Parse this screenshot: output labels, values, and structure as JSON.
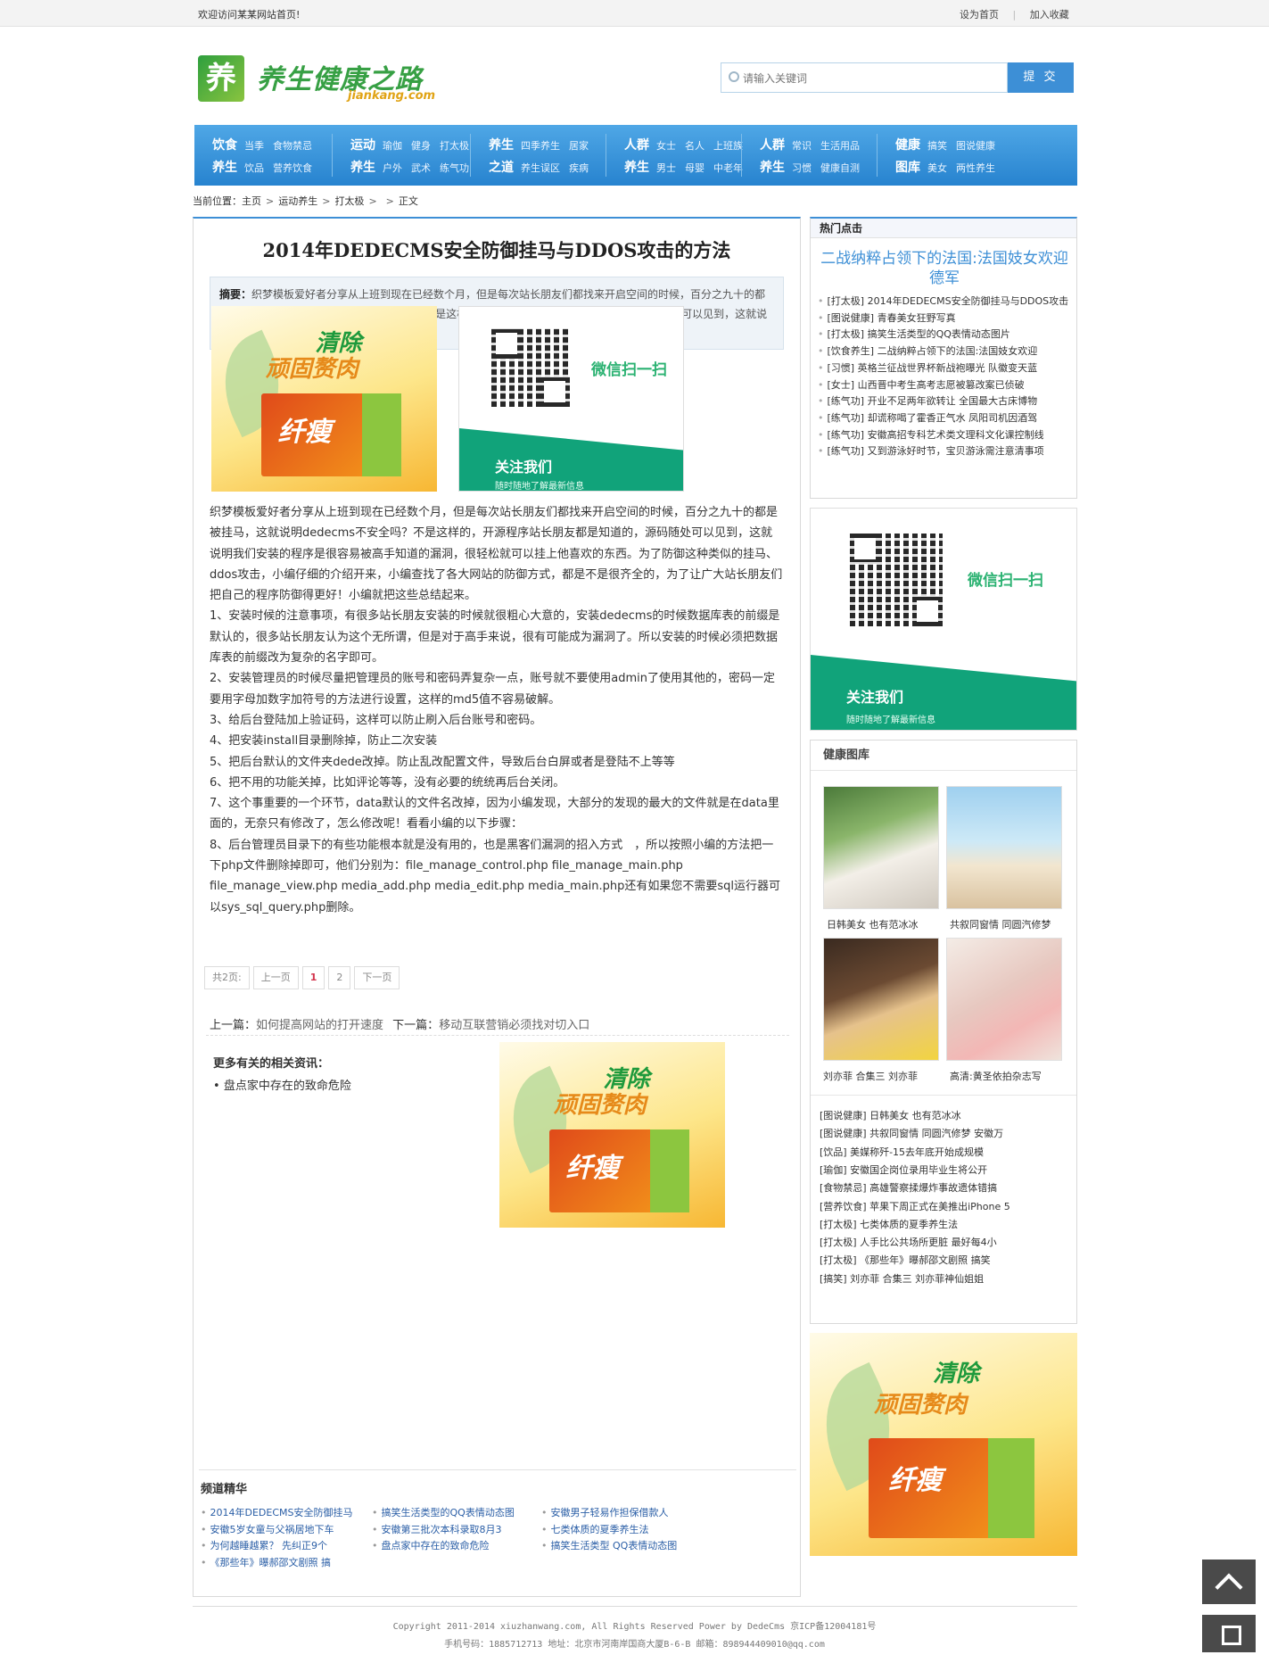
{
  "topbar": {
    "welcome": "欢迎访问某某网站首页!",
    "set_home": "设为首页",
    "add_fav": "加入收藏"
  },
  "logo": {
    "mark": "养",
    "name": "养生健康之路",
    "domain": "jiankang.com"
  },
  "search": {
    "placeholder": "请输入关键词",
    "button": "提 交"
  },
  "nav": [
    {
      "r1_cat": "饮食",
      "r1": [
        "当季",
        "食物禁忌"
      ],
      "r2_cat": "养生",
      "r2": [
        "饮品",
        "营养饮食"
      ]
    },
    {
      "r1_cat": "运动",
      "r1": [
        "瑜伽",
        "健身",
        "打太极"
      ],
      "r2_cat": "养生",
      "r2": [
        "户外",
        "武术",
        "练气功"
      ]
    },
    {
      "r1_cat": "养生",
      "r1": [
        "四季养生",
        "居家"
      ],
      "r2_cat": "之道",
      "r2": [
        "养生误区",
        "疾病"
      ]
    },
    {
      "r1_cat": "人群",
      "r1": [
        "女士",
        "名人",
        "上班族"
      ],
      "r2_cat": "养生",
      "r2": [
        "男士",
        "母婴",
        "中老年"
      ]
    },
    {
      "r1_cat": "人群",
      "r1": [
        "常识",
        "生活用品"
      ],
      "r2_cat": "养生",
      "r2": [
        "习惯",
        "健康自测"
      ]
    },
    {
      "r1_cat": "健康",
      "r1": [
        "搞笑",
        "图说健康"
      ],
      "r2_cat": "图库",
      "r2": [
        "美女",
        "两性养生"
      ]
    }
  ],
  "breadcrumb": {
    "label": "当前位置：",
    "items": [
      "主页",
      "运动养生",
      "打太极",
      "",
      "正文"
    ]
  },
  "article": {
    "title": "2014年DEDECMS安全防御挂马与DDOS攻击的方法",
    "abstract_label": "摘要：",
    "abstract": "织梦模板爱好者分享从上班到现在已经数个月，但是每次站长朋友们都找来开启空间的时候，百分之九十的都是被挂马，这就说明 dedecms 不安全吗？不是这样的，开源程序站长朋友都是知道的，源码随处可以见到，这就说明我们安装的程序是很容易被高手知道的漏洞，",
    "paragraphs": [
      "织梦模板爱好者分享从上班到现在已经数个月，但是每次站长朋友们都找来开启空间的时候，百分之九十的都是被挂马，这就说明dedecms不安全吗？不是这样的，开源程序站长朋友都是知道的，源码随处可以见到，这就说明我们安装的程序是很容易被高手知道的漏洞，很轻松就可以挂上他喜欢的东西。为了防御这种类似的挂马、ddos攻击，小编仔细的介绍开来，小编查找了各大网站的防御方式，都是不是很齐全的，为了让广大站长朋友们把自己的程序防御得更好！小编就把这些总结起来。",
      "1、安装时候的注意事项，有很多站长朋友安装的时候就很粗心大意的，安装dedecms的时候数据库表的前缀是默认的，很多站长朋友认为这个无所谓，但是对于高手来说，很有可能成为漏洞了。所以安装的时候必须把数据库表的前缀改为复杂的名字即可。",
      "2、安装管理员的时候尽量把管理员的账号和密码弄复杂一点，账号就不要使用admin了使用其他的，密码一定要用字母加数字加符号的方法进行设置，这样的md5值不容易破解。",
      "3、给后台登陆加上验证码，这样可以防止刷入后台账号和密码。",
      "4、把安装install目录删除掉，防止二次安装",
      "5、把后台默认的文件夹dede改掉。防止乱改配置文件，导致后台白屏或者是登陆不上等等",
      "6、把不用的功能关掉，比如评论等等，没有必要的统统再后台关闭。",
      "7、这个事重要的一个环节，data默认的文件名改掉，因为小编发现，大部分的发现的最大的文件就是在data里面的，无奈只有修改了，怎么修改呢！看看小编的以下步骤：",
      "8、后台管理员目录下的有些功能根本就是没有用的，也是黑客们漏洞的招入方式　，所以按照小编的方法把一下php文件删除掉即可，他们分别为：file_manage_control.php file_manage_main.php file_manage_view.php media_add.php media_edit.php media_main.php还有如果您不需要sql运行器可以sys_sql_query.php删除。"
    ],
    "promo": {
      "line1": "清除",
      "line2": "顽固赘肉",
      "brand": "纤瘦"
    },
    "qr": {
      "scan": "微信扫一扫",
      "follow": "关注我们",
      "tip": "随时随地了解最新信息"
    }
  },
  "pager": {
    "total": "共2页:",
    "prev": "上一页",
    "p1": "1",
    "p2": "2",
    "next": "下一页"
  },
  "prevnext": {
    "prev_label": "上一篇：",
    "prev_title": "如何提高网站的打开速度",
    "next_label": "下一篇：",
    "next_title": "移动互联营销必须找对切入口"
  },
  "related": {
    "title": "更多有关的相关资讯：",
    "items": [
      "盘点家中存在的致命危险"
    ]
  },
  "channel": {
    "title": "频道精华",
    "items": [
      "2014年DEDECMS安全防御挂马",
      "搞笑生活类型的QQ表情动态图",
      "安徽男子轻易作担保借款人",
      "安徽5岁女童与父祸居地下车",
      "安徽第三批次本科录取8月3",
      "七类体质的夏季养生法",
      "为何越睡越累？ 先纠正9个",
      "盘点家中存在的致命危险",
      "搞笑生活类型 QQ表情动态图",
      "《那些年》曝郝邵文剧照 搞"
    ]
  },
  "hot": {
    "title": "热门点击",
    "headline": "二战纳粹占领下的法国:法国妓女欢迎德军",
    "items": [
      "[打太极] 2014年DEDECMS安全防御挂马与DDOS攻击",
      "[图说健康] 青春美女狂野写真",
      "[打太极] 搞笑生活类型的QQ表情动态图片",
      "[饮食养生] 二战纳粹占领下的法国:法国妓女欢迎",
      "[习惯] 英格兰征战世界杯新战袍曝光 队徽变天蓝",
      "[女士] 山西晋中考生高考志愿被篡改案已侦破",
      "[练气功] 开业不足两年欲转让 全国最大古床博物",
      "[练气功] 却谎称喝了霍香正气水 凤阳司机因酒驾",
      "[练气功] 安徽高招专科艺术类文理科文化课控制线",
      "[练气功] 又到游泳好时节，宝贝游泳需注意清事项"
    ]
  },
  "side_qr": {
    "scan": "微信扫一扫",
    "follow": "关注我们",
    "tip": "随时随地了解最新信息"
  },
  "gallery": {
    "title": "健康图库",
    "thumbs": [
      "日韩美女 也有范冰冰",
      "共叙同窗情 同圆汽修梦",
      "刘亦菲 合集三 刘亦菲",
      "高清:黄圣依拍杂志写"
    ],
    "items": [
      "[图说健康] 日韩美女 也有范冰冰",
      "[图说健康] 共叙同窗情 同圆汽修梦 安徽万",
      "[饮品] 美媒称歼-15去年底开始成规模",
      "[瑜伽] 安徽国企岗位录用毕业生将公开",
      "[食物禁忌] 高雄警察揉爆炸事故遗体错搞",
      "[营养饮食] 苹果下周正式在美推出iPhone 5",
      "[打太极] 七类体质的夏季养生法",
      "[打太极] 人手比公共场所更脏 最好每4小",
      "[打太极] 《那些年》曝郝邵文剧照 搞笑",
      "[搞笑] 刘亦菲 合集三 刘亦菲神仙姐姐"
    ]
  },
  "footer": {
    "line1": "Copyright 2011-2014 xiuzhanwang.com, All Rights Reserved Power by DedeCms 京ICP备12004181号",
    "line2": "手机号码：1885712713 地址：北京市河南岸国商大厦B-6-B 邮箱：898944409010@qq.com"
  }
}
